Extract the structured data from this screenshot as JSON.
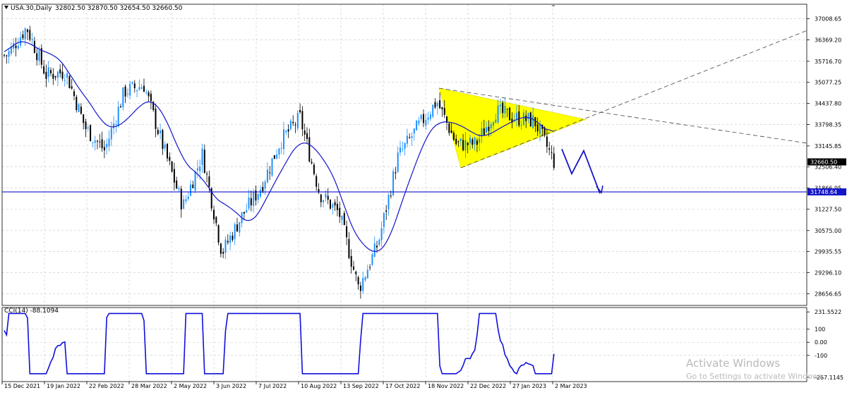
{
  "header": {
    "title": "USA.30,Daily",
    "ohlc": "32802.50 32870.50 32654.50 32660.50"
  },
  "indicator": {
    "label": "CCI(14) -88.1094"
  },
  "watermark": {
    "line1": "Activate Windows",
    "line2": "Go to Settings to activate Windows."
  },
  "colors": {
    "bull": "#1e90ff",
    "bear": "#000000",
    "ma": "#1515c8",
    "support": "#1515c8",
    "triangle": "#ffff00",
    "cci": "#1010dd",
    "price_tag": "#000000",
    "support_tag": "#1515c8"
  },
  "chart_data": [
    {
      "type": "candlestick",
      "symbol": "USA.30",
      "timeframe": "Daily",
      "last": {
        "open": 32802.5,
        "high": 32870.5,
        "low": 32654.5,
        "close": 32660.5
      },
      "ylim": [
        28300,
        37450
      ],
      "yticks": [
        "37008.65",
        "36369.20",
        "35716.70",
        "35077.25",
        "34437.80",
        "33798.35",
        "33145.85",
        "32506.40",
        "31866.95",
        "31227.50",
        "30575.00",
        "29935.55",
        "29296.10",
        "28656.65"
      ],
      "xtick_labels": [
        "15 Dec 2021",
        "19 Jan 2022",
        "22 Feb 2022",
        "28 Mar 2022",
        "2 May 2022",
        "3 Jun 2022",
        "7 Jul 2022",
        "10 Aug 2022",
        "13 Sep 2022",
        "17 Oct 2022",
        "18 Nov 2022",
        "22 Dec 2022",
        "27 Jan 2023",
        "2 Mar 2023"
      ],
      "price_label": "32660.50",
      "support_label": "31748.64",
      "support_level": 31748.64,
      "closes": [
        {
          "date": "15 Dec 2021",
          "close": 35900
        },
        {
          "date": "5 Jan 2022",
          "close": 36750
        },
        {
          "date": "19 Jan 2022",
          "close": 35300
        },
        {
          "date": "2 Feb 2022",
          "close": 35400
        },
        {
          "date": "22 Feb 2022",
          "close": 33700
        },
        {
          "date": "8 Mar 2022",
          "close": 33000
        },
        {
          "date": "28 Mar 2022",
          "close": 34800
        },
        {
          "date": "5 Apr 2022",
          "close": 35000
        },
        {
          "date": "2 May 2022",
          "close": 33100
        },
        {
          "date": "19 May 2022",
          "close": 31300
        },
        {
          "date": "3 Jun 2022",
          "close": 32900
        },
        {
          "date": "17 Jun 2022",
          "close": 29900
        },
        {
          "date": "7 Jul 2022",
          "close": 31000
        },
        {
          "date": "20 Jul 2022",
          "close": 31900
        },
        {
          "date": "10 Aug 2022",
          "close": 33300
        },
        {
          "date": "16 Aug 2022",
          "close": 34000
        },
        {
          "date": "29 Aug 2022",
          "close": 31700
        },
        {
          "date": "13 Sep 2022",
          "close": 31100
        },
        {
          "date": "30 Sep 2022",
          "close": 28800
        },
        {
          "date": "17 Oct 2022",
          "close": 30200
        },
        {
          "date": "31 Oct 2022",
          "close": 32800
        },
        {
          "date": "18 Nov 2022",
          "close": 33700
        },
        {
          "date": "1 Dec 2022",
          "close": 34500
        },
        {
          "date": "12 Dec 2022",
          "close": 33200
        },
        {
          "date": "22 Dec 2022",
          "close": 33200
        },
        {
          "date": "13 Jan 2023",
          "close": 34200
        },
        {
          "date": "27 Jan 2023",
          "close": 34000
        },
        {
          "date": "8 Feb 2023",
          "close": 33900
        },
        {
          "date": "24 Feb 2023",
          "close": 32660.5
        }
      ],
      "annotations": [
        "symmetrical triangle (yellow)",
        "dashed projection lines",
        "projected zig-zag path to support",
        "horizontal support line"
      ]
    },
    {
      "type": "line",
      "series_name": "CCI(14)",
      "current": -88.1094,
      "ylim": [
        -300,
        265
      ],
      "yticks": [
        "231.5522",
        "100",
        "0.00",
        "-100",
        "-267.1145"
      ]
    }
  ]
}
